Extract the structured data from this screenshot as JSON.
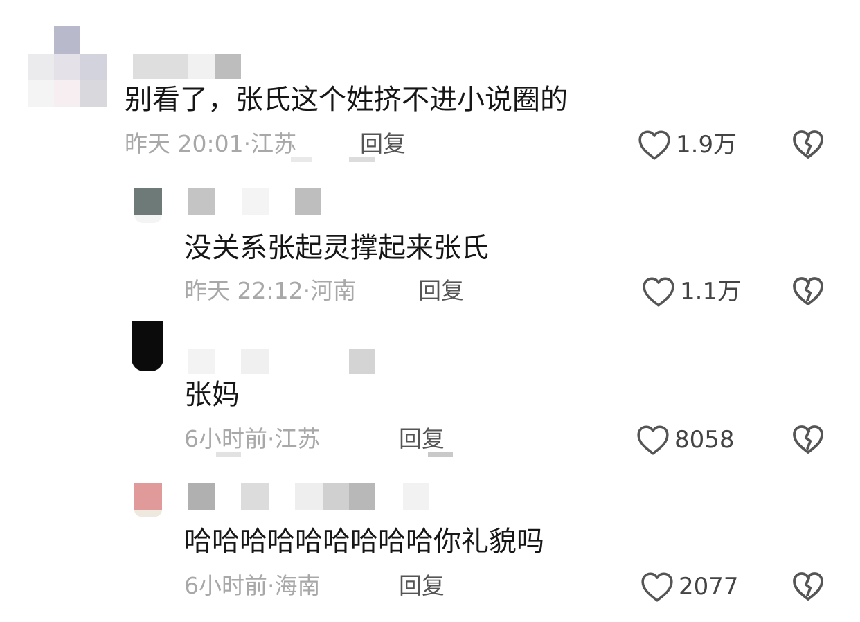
{
  "comments": [
    {
      "text": "别看了，张氏这个姓挤不进小说圈的",
      "time": "昨天 20:01",
      "separator": "·",
      "location": "江苏",
      "reply_label": "回复",
      "likes": "1.9万",
      "level": "top"
    },
    {
      "text": "没关系张起灵撑起来张氏",
      "time": "昨天 22:12",
      "separator": "·",
      "location": "河南",
      "reply_label": "回复",
      "likes": "1.1万",
      "level": "reply"
    },
    {
      "text": "张妈",
      "time": "6小时前",
      "separator": "·",
      "location": "江苏",
      "reply_label": "回复",
      "likes": "8058",
      "level": "reply"
    },
    {
      "text": "哈哈哈哈哈哈哈哈哈你礼貌吗",
      "time": "6小时前",
      "separator": "·",
      "location": "海南",
      "reply_label": "回复",
      "likes": "2077",
      "level": "reply"
    }
  ],
  "icons": {
    "like": "heart-outline-icon",
    "dislike": "broken-heart-icon"
  },
  "colors": {
    "text": "#161616",
    "meta": "#a8a8a8",
    "reply": "#555555",
    "icon": "#555555"
  }
}
